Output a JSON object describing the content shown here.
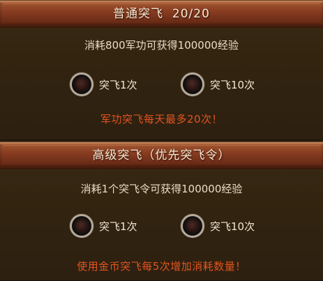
{
  "normal": {
    "title": "普通突飞  20/20",
    "description": "消耗800军功可获得100000经验",
    "option_once": "突飞1次",
    "option_ten": "突飞10次",
    "notice": "军功突飞每天最多20次！"
  },
  "advanced": {
    "title": "高级突飞（优先突飞令）",
    "description": "消耗1个突飞令可获得100000经验",
    "option_once": "突飞1次",
    "option_ten": "突飞10次",
    "notice": "使用金币突飞每5次增加消耗数量！"
  },
  "colors": {
    "header": "#8b3f22",
    "panel_bg": "#32240f",
    "text": "#e9dcc7",
    "notice": "#e2541f"
  }
}
